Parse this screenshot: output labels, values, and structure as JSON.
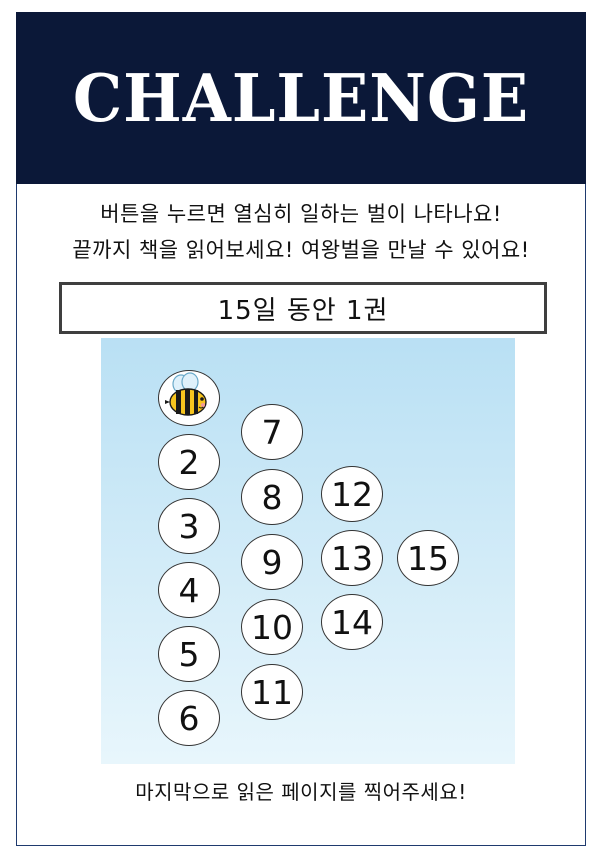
{
  "header": {
    "title": "CHALLENGE"
  },
  "intro": {
    "line1": "버튼을 누르면 열심히 일하는 벌이 나타나요!",
    "line2": "끝까지 책을 읽어보세요! 여왕벌을 만날 수 있어요!"
  },
  "goal": {
    "text": "15일 동안 1권"
  },
  "board": {
    "first_cell_icon": "bee-icon",
    "cells": [
      "2",
      "3",
      "4",
      "5",
      "6",
      "7",
      "8",
      "9",
      "10",
      "11",
      "12",
      "13",
      "14",
      "15"
    ]
  },
  "footer": {
    "text": "마지막으로 읽은 페이지를 찍어주세요!"
  },
  "colors": {
    "header_bg": "#0b1838",
    "frame_border": "#1f3a6e",
    "board_sky_top": "#b9e0f4",
    "board_sky_bottom": "#e8f6fc",
    "bee_yellow": "#f7c51e",
    "bee_black": "#1a1a1a"
  }
}
